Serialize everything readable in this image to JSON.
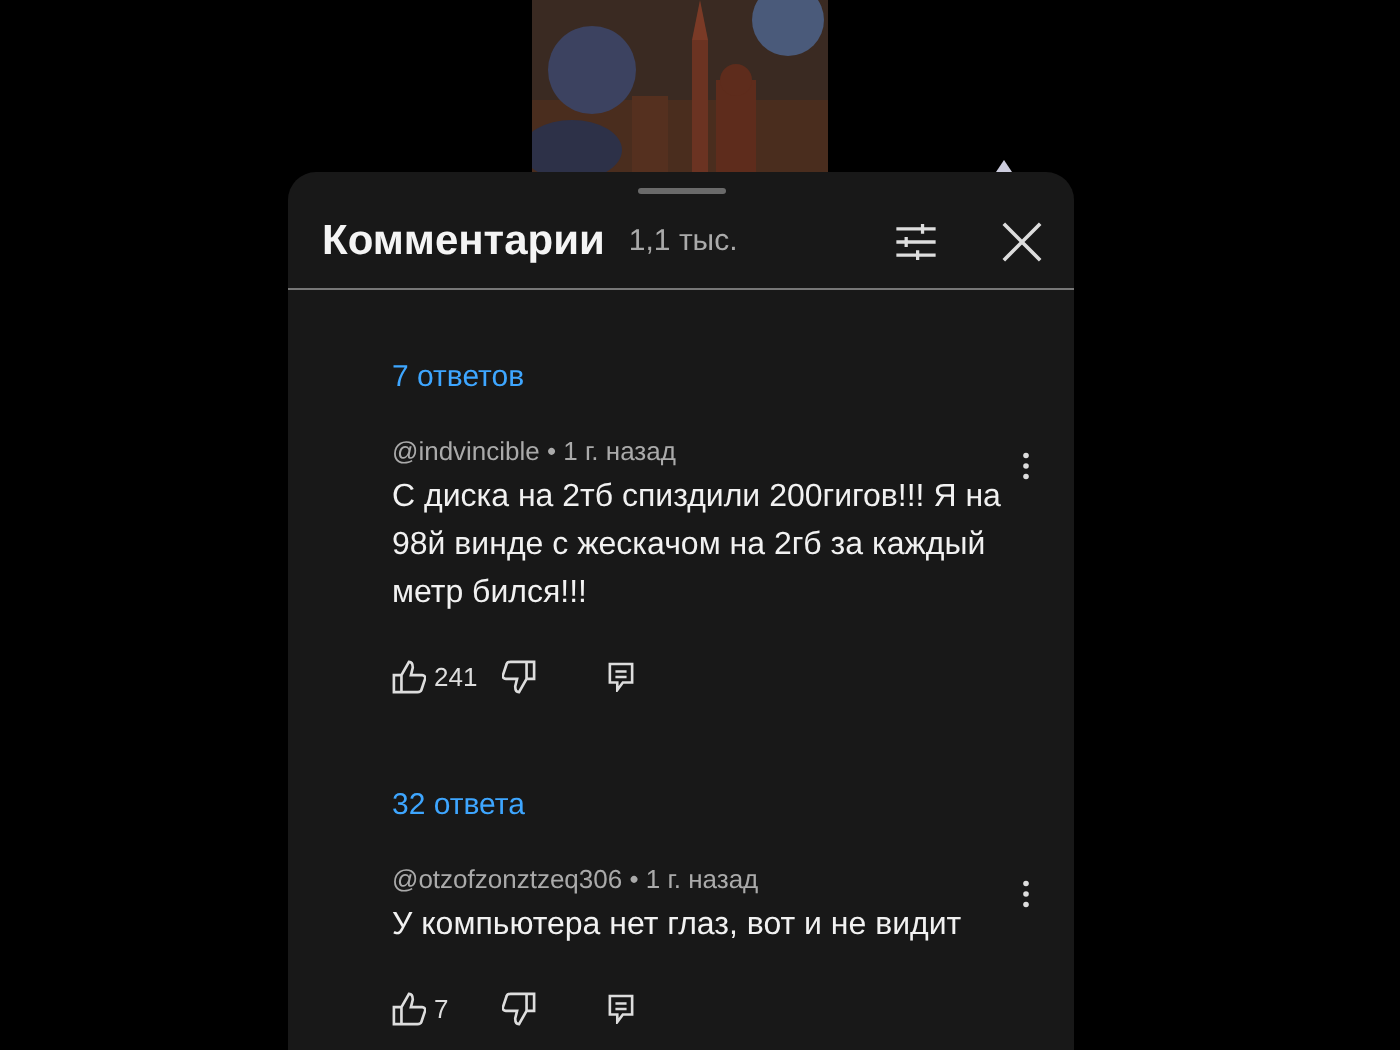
{
  "header": {
    "title": "Комментарии",
    "count": "1,1 тыс."
  },
  "items": [
    {
      "kind": "replies",
      "label": "7 ответов"
    },
    {
      "kind": "comment",
      "meta": "@indvincible • 1 г. назад",
      "text": "С диска на 2тб спиздили 200гигов!!! Я на 98й винде с жескачом на 2гб за каждый метр бился!!!",
      "likes": "241"
    },
    {
      "kind": "replies",
      "label": "32 ответа"
    },
    {
      "kind": "comment",
      "meta": "@otzofzonztzeq306 • 1 г. назад",
      "text": "У компьютера нет глаз, вот и не видит",
      "likes": "7"
    }
  ]
}
